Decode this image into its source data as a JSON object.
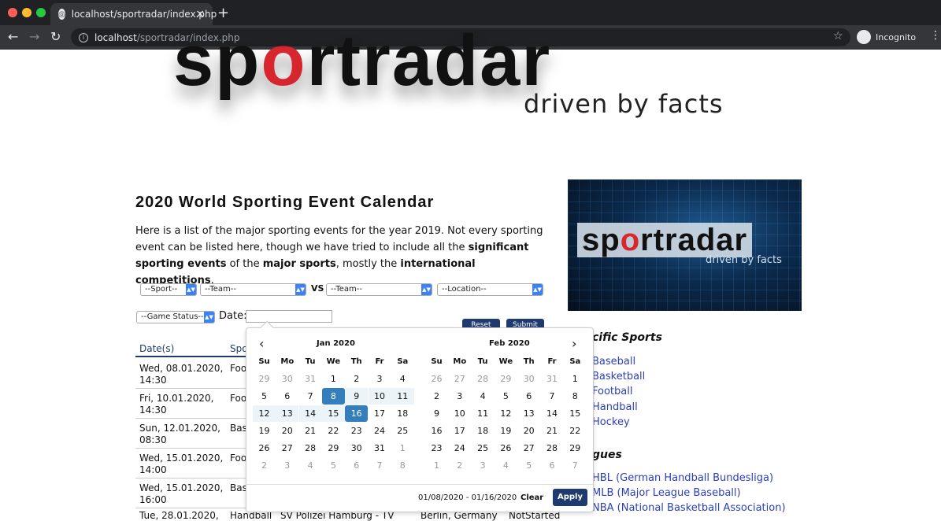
{
  "browser": {
    "tab_title": "localhost/sportradar/index.php",
    "url_host": "localhost",
    "url_path": "/sportradar/index.php",
    "profile_label": "Incognito"
  },
  "logo": {
    "text_a": "sp",
    "text_o": "o",
    "text_b": "rtradar",
    "tagline": "driven by facts"
  },
  "page": {
    "title": "2020 World Sporting Event Calendar",
    "intro_1": "Here is a list of the major sporting events for the year 2019. Not every sporting event can be listed here, though we have tried to include all the ",
    "intro_b1": "significant sporting events",
    "intro_2": " of the ",
    "intro_b2": "major sports",
    "intro_3": ", mostly the ",
    "intro_b3": "international competitions",
    "intro_4": "."
  },
  "filters": {
    "sport": "--Sport--",
    "team1": "--Team--",
    "vs": "VS",
    "team2": "--Team--",
    "location": "--Location--",
    "status": "--Game Status--",
    "date_label": "Date:",
    "reset_label": "Reset",
    "submit_label": "Submit"
  },
  "table": {
    "headers": [
      "Date(s)",
      "Spo"
    ],
    "rows": [
      {
        "date": "Wed, 08.01.2020, 14:30",
        "sport": "Foo"
      },
      {
        "date": "Fri, 10.01.2020, 14:30",
        "sport": "Foo"
      },
      {
        "date": "Sun, 12.01.2020, 08:30",
        "sport": "Bas"
      },
      {
        "date": "Wed, 15.01.2020, 14:00",
        "sport": "Foo"
      },
      {
        "date": "Wed, 15.01.2020, 16:00",
        "sport": "Bas"
      }
    ],
    "last_row": {
      "date": "Tue, 28.01.2020,",
      "sport": "Handball",
      "teams": "SV Polizei Hamburg - TV",
      "location": "Berlin, Germany",
      "status": "NotStarted"
    }
  },
  "sidebar": {
    "image_logo_a": "sp",
    "image_logo_o": "o",
    "image_logo_b": "rtradar",
    "image_tagline": "driven by facts",
    "sports_heading": "cific Sports",
    "sports": [
      "Baseball",
      "Basketball",
      "Football",
      "Handball",
      "Hockey"
    ],
    "leagues_heading": "gues",
    "leagues": [
      "HBL (German Handball Bundesliga)",
      "MLB (Major League Baseball)",
      "NBA (National Basketball Association)"
    ]
  },
  "picker": {
    "prev_icon": "‹",
    "next_icon": "›",
    "left_month": "Jan 2020",
    "right_month": "Feb 2020",
    "dow": [
      "Su",
      "Mo",
      "Tu",
      "We",
      "Th",
      "Fr",
      "Sa"
    ],
    "left_days": [
      [
        "29",
        "30",
        "31",
        "1",
        "2",
        "3",
        "4"
      ],
      [
        "5",
        "6",
        "7",
        "8",
        "9",
        "10",
        "11"
      ],
      [
        "12",
        "13",
        "14",
        "15",
        "16",
        "17",
        "18"
      ],
      [
        "19",
        "20",
        "21",
        "22",
        "23",
        "24",
        "25"
      ],
      [
        "26",
        "27",
        "28",
        "29",
        "30",
        "31",
        "1"
      ],
      [
        "2",
        "3",
        "4",
        "5",
        "6",
        "7",
        "8"
      ]
    ],
    "right_days": [
      [
        "26",
        "27",
        "28",
        "29",
        "30",
        "31",
        "1"
      ],
      [
        "2",
        "3",
        "4",
        "5",
        "6",
        "7",
        "8"
      ],
      [
        "9",
        "10",
        "11",
        "12",
        "13",
        "14",
        "15"
      ],
      [
        "16",
        "17",
        "18",
        "19",
        "20",
        "21",
        "22"
      ],
      [
        "23",
        "24",
        "25",
        "26",
        "27",
        "28",
        "29"
      ],
      [
        "1",
        "2",
        "3",
        "4",
        "5",
        "6",
        "7"
      ]
    ],
    "range_text": "01/08/2020 - 01/16/2020",
    "clear_label": "Clear",
    "apply_label": "Apply"
  }
}
